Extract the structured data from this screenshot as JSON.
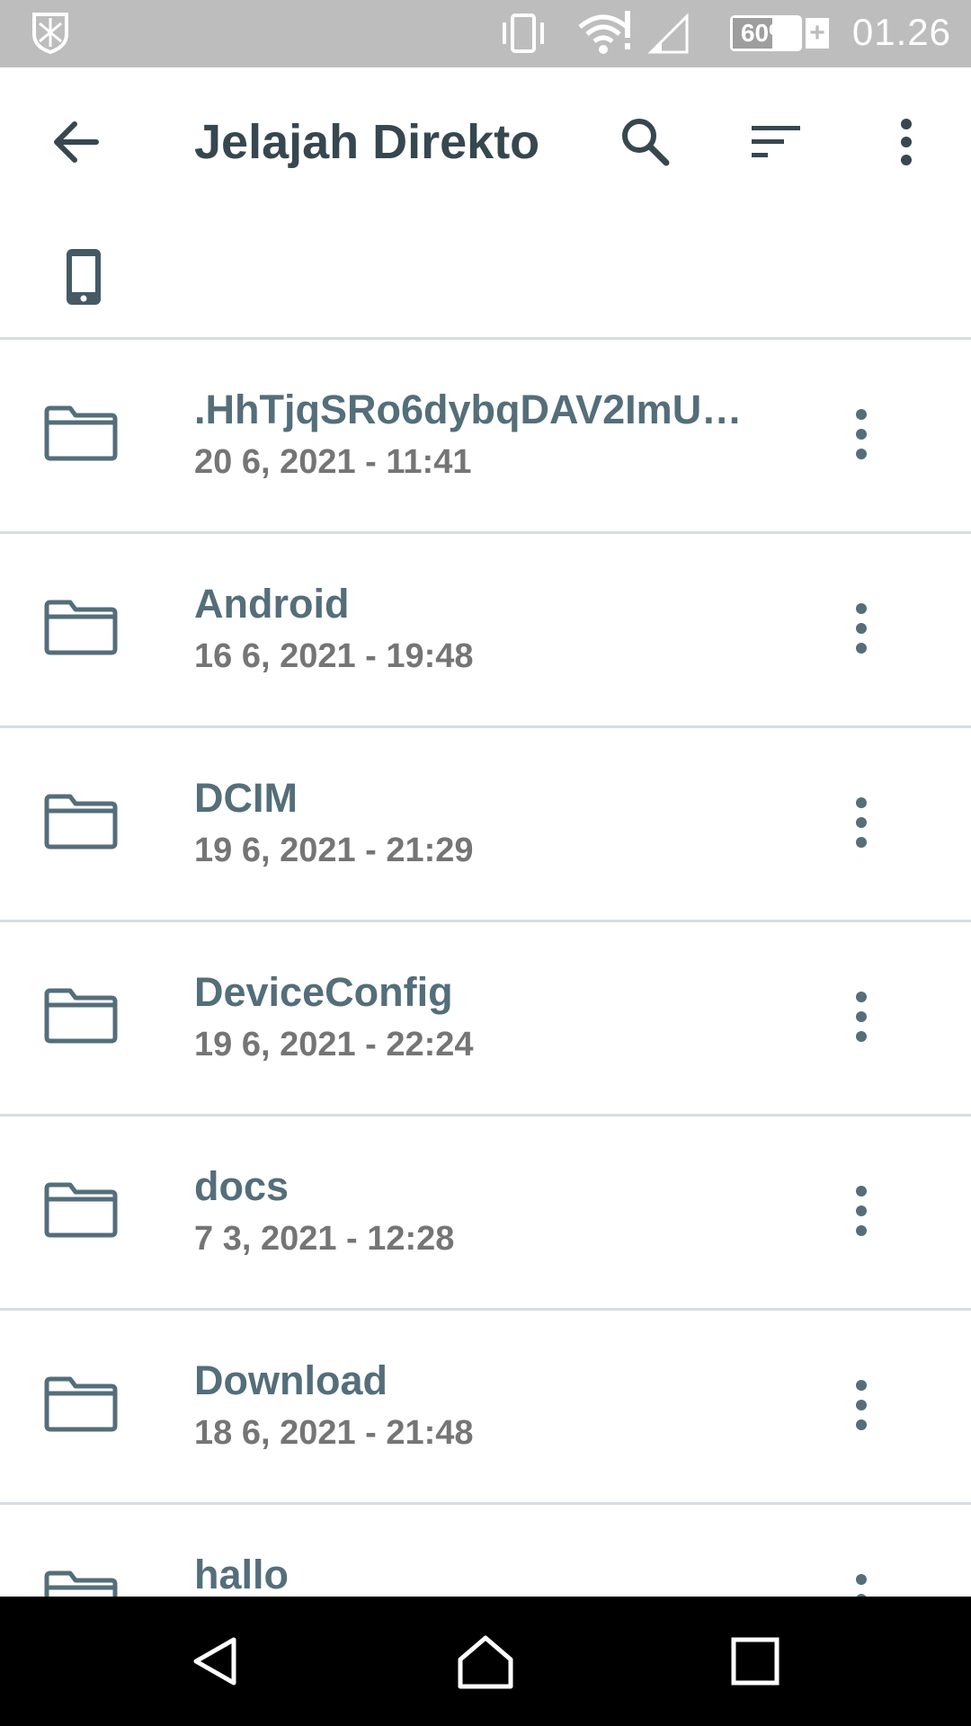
{
  "status_bar": {
    "time": "01.26",
    "battery": "60%",
    "battery_level": 0.6,
    "icons": [
      "notification-shield-icon",
      "vibrate-icon",
      "wifi-icon",
      "cell-signal-icon",
      "battery-icon",
      "charging-plus-icon"
    ]
  },
  "app_bar": {
    "title": "Jelajah Direkto",
    "icons": [
      "back-arrow-icon",
      "search-icon",
      "sort-icon",
      "more-vert-icon"
    ]
  },
  "storage": {
    "icon": "phone-icon"
  },
  "files": [
    {
      "name": ".HhTjqSRo6dybqDAV2ImU…",
      "date": "20 6, 2021 - 11:41"
    },
    {
      "name": "Android",
      "date": "16 6, 2021 - 19:48"
    },
    {
      "name": "DCIM",
      "date": "19 6, 2021 - 21:29"
    },
    {
      "name": "DeviceConfig",
      "date": "19 6, 2021 - 22:24"
    },
    {
      "name": "docs",
      "date": "7 3, 2021 - 12:28"
    },
    {
      "name": "Download",
      "date": "18 6, 2021 - 21:48"
    },
    {
      "name": "hallo",
      "date": ""
    }
  ],
  "colors": {
    "accent": "#37474f",
    "item_name": "#546e7a",
    "item_date": "#757575",
    "divider": "#d7dee2",
    "status_bar_bg": "#bdbdbd",
    "nav_bar_bg": "#000000"
  },
  "nav_bar": {
    "icons": [
      "nav-back-icon",
      "nav-home-icon",
      "nav-recents-icon"
    ]
  }
}
